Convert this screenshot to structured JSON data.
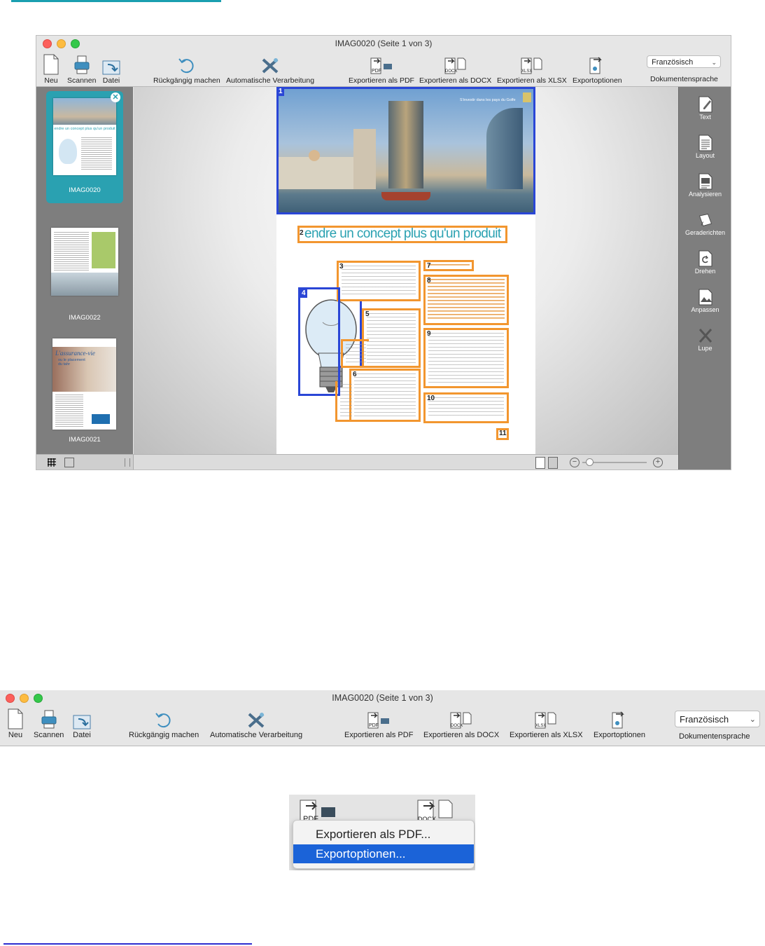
{
  "window": {
    "title": "IMAG0020 (Seite 1 von 3)"
  },
  "toolbar": {
    "neu": "Neu",
    "scannen": "Scannen",
    "datei": "Datei",
    "undo": "Rückgängig machen",
    "auto": "Automatische Verarbeitung",
    "export_pdf": "Exportieren als PDF",
    "export_docx": "Exportieren als DOCX",
    "export_xlsx": "Exportieren als XLSX",
    "export_options": "Exportoptionen",
    "language_value": "Französisch",
    "language_label": "Dokumentensprache",
    "icon_pdf": "PDF",
    "icon_docx": "DOCX",
    "icon_xlsx": "XLSX"
  },
  "sidebar": {
    "items": [
      {
        "label": "IMAG0020",
        "selected": true
      },
      {
        "label": "IMAG0022",
        "selected": false
      },
      {
        "label": "IMAG0021",
        "selected": false
      }
    ],
    "thumb1_title": "endre un concept plus qu'un produit",
    "thumb3_title": "L'assurance-vie",
    "thumb3_sub": "ou le placement du tahr"
  },
  "rightbar": {
    "items": [
      "Text",
      "Layout",
      "Analysieren",
      "Geraderichten",
      "Drehen",
      "Anpassen",
      "Lupe"
    ]
  },
  "document": {
    "header_text": "S'investir dans les pays du Golfe",
    "headline": "endre un concept plus qu'un produit",
    "regions": [
      "1",
      "2",
      "3",
      "4",
      "5",
      "6",
      "7",
      "8",
      "9",
      "10",
      "11"
    ]
  },
  "popup": {
    "items": [
      {
        "label": "Exportieren als PDF...",
        "selected": false
      },
      {
        "label": "Exportoptionen...",
        "selected": true
      }
    ]
  },
  "colors": {
    "accent": "#2aa1b1",
    "region_orange": "#f2962f",
    "region_blue": "#2a46d6",
    "menu_highlight": "#1b63d8"
  }
}
